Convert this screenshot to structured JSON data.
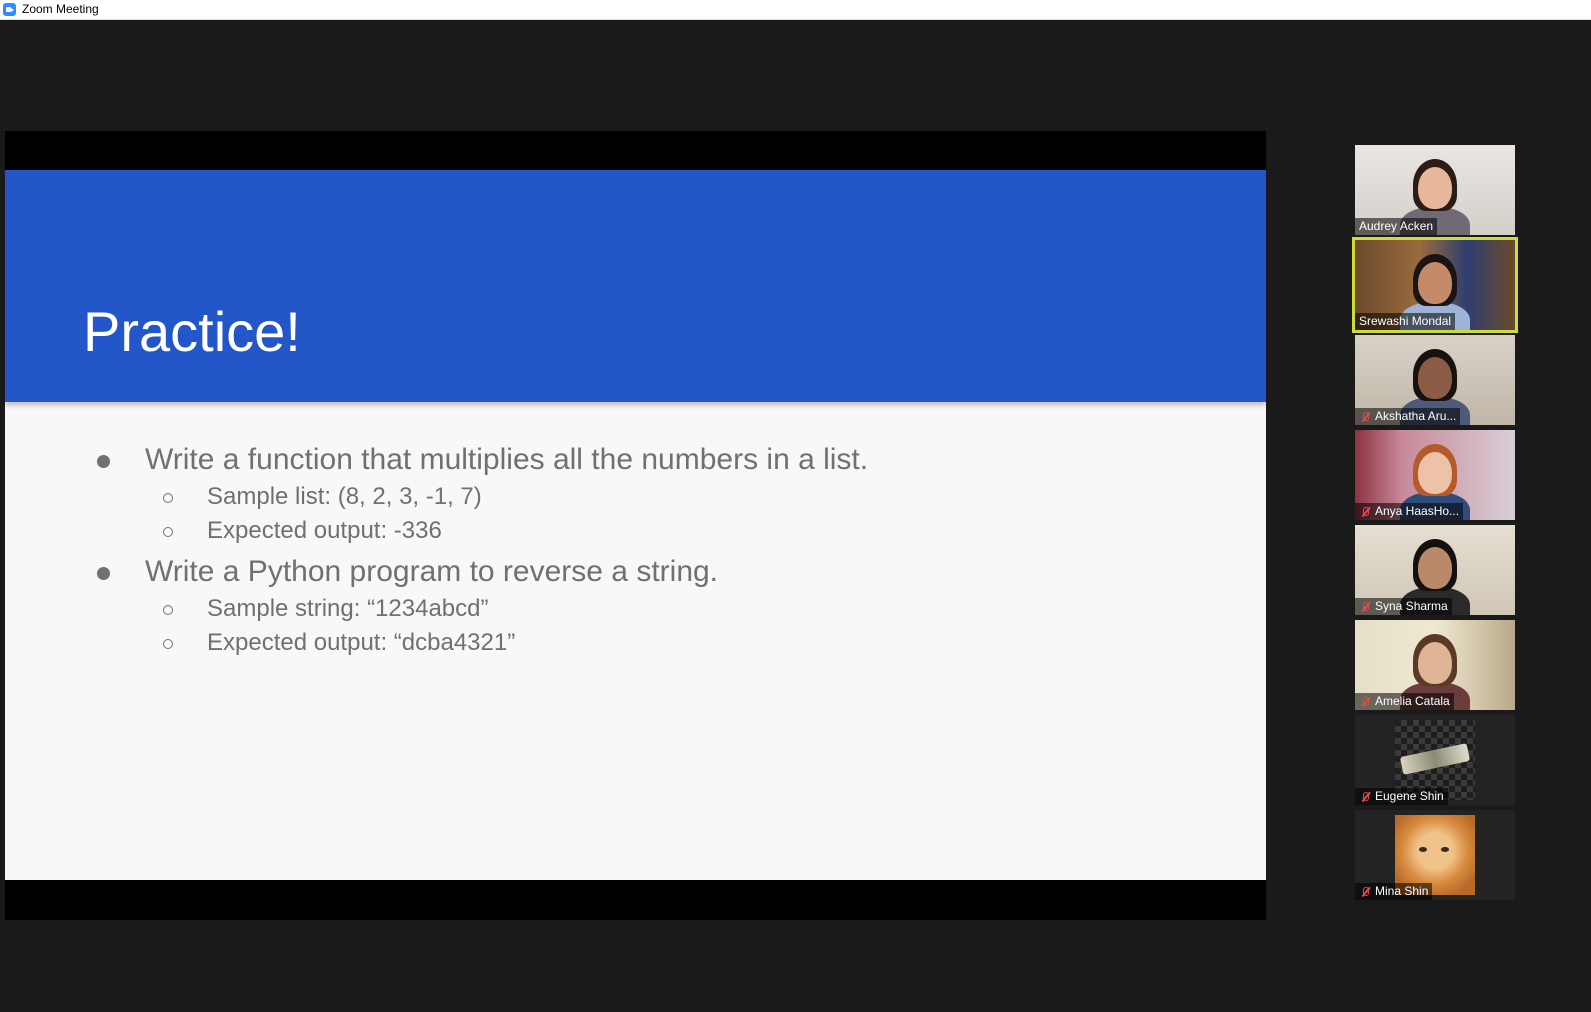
{
  "window": {
    "title": "Zoom Meeting"
  },
  "slide": {
    "title": "Practice!",
    "bullets": [
      {
        "level": 1,
        "text": "Write a function that multiplies all the numbers in a list."
      },
      {
        "level": 2,
        "text": "Sample list: (8, 2, 3, -1, 7)"
      },
      {
        "level": 2,
        "text": "Expected output: -336"
      },
      {
        "level": 1,
        "text": "Write a Python program to reverse a string."
      },
      {
        "level": 2,
        "text": "Sample string: “1234abcd”"
      },
      {
        "level": 2,
        "text": "Expected output: “dcba4321”"
      }
    ],
    "colors": {
      "header": "#2356c8",
      "body": "#f8f8f8",
      "text": "#707070"
    }
  },
  "participants": [
    {
      "name": "Audrey Acken",
      "muted": false,
      "active_speaker": false,
      "video": "camera"
    },
    {
      "name": "Srewashi Mondal",
      "muted": false,
      "active_speaker": true,
      "video": "camera"
    },
    {
      "name": "Akshatha Aru...",
      "muted": true,
      "active_speaker": false,
      "video": "camera"
    },
    {
      "name": "Anya HaasHo...",
      "muted": true,
      "active_speaker": false,
      "video": "camera"
    },
    {
      "name": "Syna Sharma",
      "muted": true,
      "active_speaker": false,
      "video": "camera"
    },
    {
      "name": "Amelia Catala",
      "muted": true,
      "active_speaker": false,
      "video": "camera"
    },
    {
      "name": "Eugene Shin",
      "muted": true,
      "active_speaker": false,
      "video": "profile-picture"
    },
    {
      "name": "Mina Shin",
      "muted": true,
      "active_speaker": false,
      "video": "profile-picture"
    }
  ],
  "accent_colors": {
    "active_speaker_border": "#cddc39",
    "muted_icon": "#e5484d"
  }
}
